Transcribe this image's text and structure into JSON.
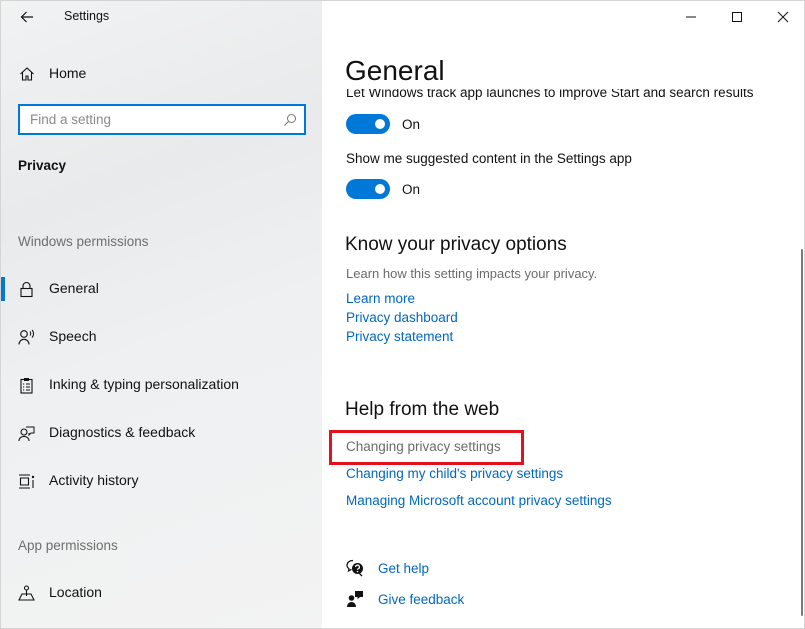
{
  "window": {
    "title": "Settings",
    "controls": {
      "minimize": "minimize",
      "maximize": "maximize",
      "close": "close"
    }
  },
  "sidebar": {
    "home_label": "Home",
    "search": {
      "placeholder": "Find a setting",
      "value": ""
    },
    "section_title": "Privacy",
    "groups": [
      {
        "label": "Windows permissions",
        "items": [
          {
            "label": "General",
            "icon": "lock-icon",
            "active": true
          },
          {
            "label": "Speech",
            "icon": "speech-icon",
            "active": false
          },
          {
            "label": "Inking & typing personalization",
            "icon": "clipboard-icon",
            "active": false
          },
          {
            "label": "Diagnostics & feedback",
            "icon": "diagnostics-icon",
            "active": false
          },
          {
            "label": "Activity history",
            "icon": "activity-history-icon",
            "active": false
          }
        ]
      },
      {
        "label": "App permissions",
        "items": [
          {
            "label": "Location",
            "icon": "location-icon",
            "active": false
          }
        ]
      }
    ]
  },
  "main": {
    "page_title": "General",
    "settings": [
      {
        "label": "Let Windows track app launches to improve Start and search results",
        "state": "On",
        "enabled": true
      },
      {
        "label": "Show me suggested content in the Settings app",
        "state": "On",
        "enabled": true
      }
    ],
    "privacy_options": {
      "heading": "Know your privacy options",
      "description": "Learn how this setting impacts your privacy.",
      "links": [
        "Learn more",
        "Privacy dashboard",
        "Privacy statement"
      ]
    },
    "help_from_web": {
      "heading": "Help from the web",
      "links": [
        {
          "label": "Changing privacy settings",
          "visited": true,
          "highlighted": true
        },
        {
          "label": "Changing my child's privacy settings",
          "visited": false
        },
        {
          "label": "Managing Microsoft account privacy settings",
          "visited": false
        }
      ]
    },
    "help_actions": [
      {
        "label": "Get help",
        "icon": "get-help-icon"
      },
      {
        "label": "Give feedback",
        "icon": "give-feedback-icon"
      }
    ]
  },
  "colors": {
    "accent": "#0078d7",
    "link": "#0067c0",
    "highlight": "#e3101e"
  }
}
